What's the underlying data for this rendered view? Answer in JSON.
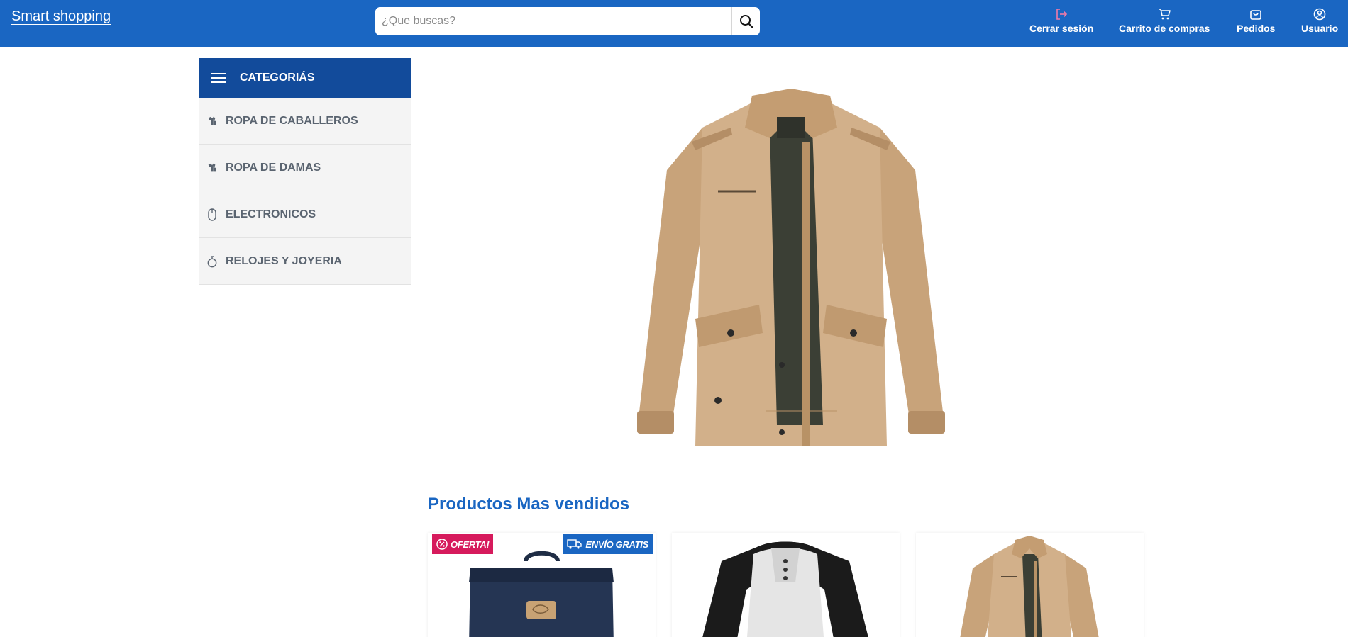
{
  "header": {
    "brand": "Smart shopping",
    "search_placeholder": "¿Que buscas?",
    "nav": [
      {
        "label": "Cerrar sesión",
        "icon": "logout-icon"
      },
      {
        "label": "Carrito de compras",
        "icon": "cart-icon"
      },
      {
        "label": "Pedidos",
        "icon": "bag-icon"
      },
      {
        "label": "Usuario",
        "icon": "user-icon"
      }
    ]
  },
  "sidebar": {
    "title": "CATEGORIÁS",
    "items": [
      {
        "label": "ROPA DE CABALLEROS",
        "icon": "hanger-icon"
      },
      {
        "label": "ROPA DE DAMAS",
        "icon": "hanger-icon"
      },
      {
        "label": "ELECTRONICOS",
        "icon": "mouse-icon"
      },
      {
        "label": "RELOJES Y JOYERIA",
        "icon": "stopwatch-icon"
      }
    ]
  },
  "hero": {
    "image": "jacket"
  },
  "bestsellers": {
    "title": "Productos Mas vendidos",
    "products": [
      {
        "image": "backpack",
        "badges": [
          "OFERTA!",
          "ENVÍO GRATIS"
        ]
      },
      {
        "image": "shirt",
        "badges": []
      },
      {
        "image": "jacket",
        "badges": []
      }
    ]
  },
  "colors": {
    "primary": "#1a66c2",
    "sidebar_header": "#124b9b",
    "offer_badge": "#d61a5c",
    "logout_icon": "#f07aa8"
  }
}
